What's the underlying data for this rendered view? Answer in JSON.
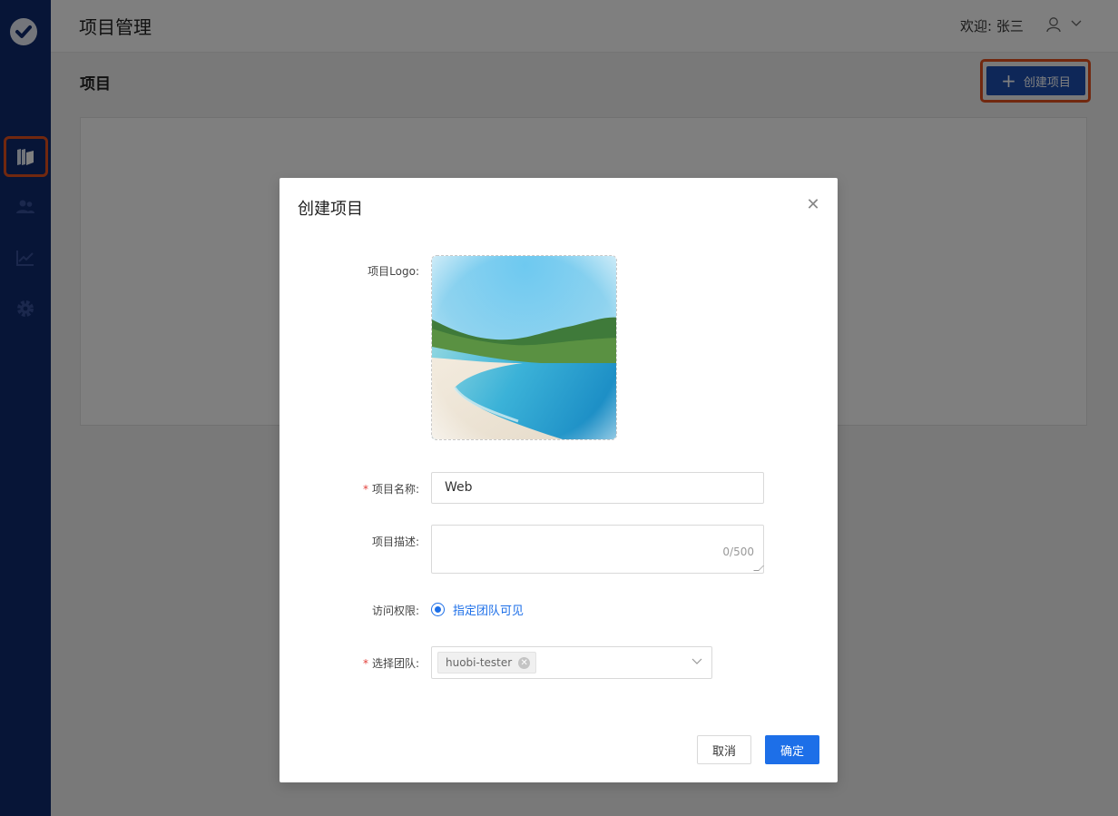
{
  "header": {
    "title": "项目管理",
    "welcome": "欢迎: 张三"
  },
  "page": {
    "title": "项目",
    "create_button_label": "创建项目"
  },
  "sidebar": {
    "items": [
      {
        "icon": "projects-icon",
        "active": true
      },
      {
        "icon": "team-icon",
        "active": false
      },
      {
        "icon": "chart-icon",
        "active": false
      },
      {
        "icon": "gear-icon",
        "active": false
      }
    ]
  },
  "modal": {
    "title": "创建项目",
    "logo_label": "项目Logo:",
    "name_label": "项目名称:",
    "name_value": "Web",
    "desc_label": "项目描述:",
    "desc_counter": "0/500",
    "access_label": "访问权限:",
    "access_option": "指定团队可见",
    "team_label": "选择团队:",
    "team_tag": "huobi-tester",
    "cancel_label": "取消",
    "ok_label": "确定"
  },
  "colors": {
    "sidebar": "#0f2a6e",
    "primary": "#1d4fb1",
    "accent": "#1d6fe8",
    "highlight": "#e2511f"
  }
}
